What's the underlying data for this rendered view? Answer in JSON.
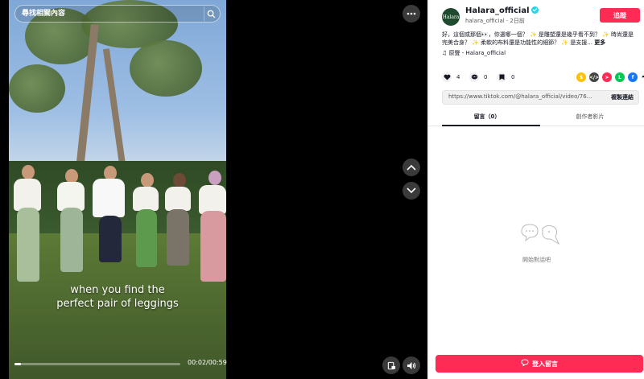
{
  "search": {
    "placeholder": "尋找相關內容",
    "icon": "search-icon"
  },
  "video": {
    "caption_line1": "when you find the",
    "caption_line2": "perfect pair of leggings",
    "time": "00:02/00:59",
    "progress_fraction": 0.04
  },
  "controls": {
    "more_icon": "more-icon",
    "prev_icon": "chevron-up-icon",
    "next_icon": "chevron-down-icon",
    "pip_icon": "pip-icon",
    "volume_icon": "volume-icon"
  },
  "account": {
    "avatar_text": "Halara",
    "name": "Halara_official",
    "sub": "halara_official · 2日前",
    "follow_label": "追蹤"
  },
  "description": {
    "text": "好，這個或那個👀，你選哪一個？ ✨ 是雕塑還是幾乎看不到？ ✨ 時尚還是完美合身？ ✨ 柔軟的布料還是功能性的細節？ ✨ 是支援...",
    "more_label": "更多",
    "music": "♫ 原聲 - Halara_official"
  },
  "stats": {
    "likes": "4",
    "comments": "0",
    "saves": "0"
  },
  "share_colors": {
    "coin": "#ffc107",
    "embed": "#444444",
    "send": "#fe2c55",
    "line": "#06c755",
    "facebook": "#1877f2"
  },
  "link": {
    "url": "https://www.tiktok.com/@halara_official/video/7683241...",
    "copy_label": "複製連結"
  },
  "tabs": [
    {
      "label": "留言（0）"
    },
    {
      "label": "創作者影片"
    }
  ],
  "empty": {
    "text": "開始對話吧"
  },
  "comment_button": {
    "label": "登入留言"
  },
  "colors": {
    "accent": "#fe2c55",
    "panel_bg": "#ffffff",
    "stage_bg": "#000000"
  }
}
